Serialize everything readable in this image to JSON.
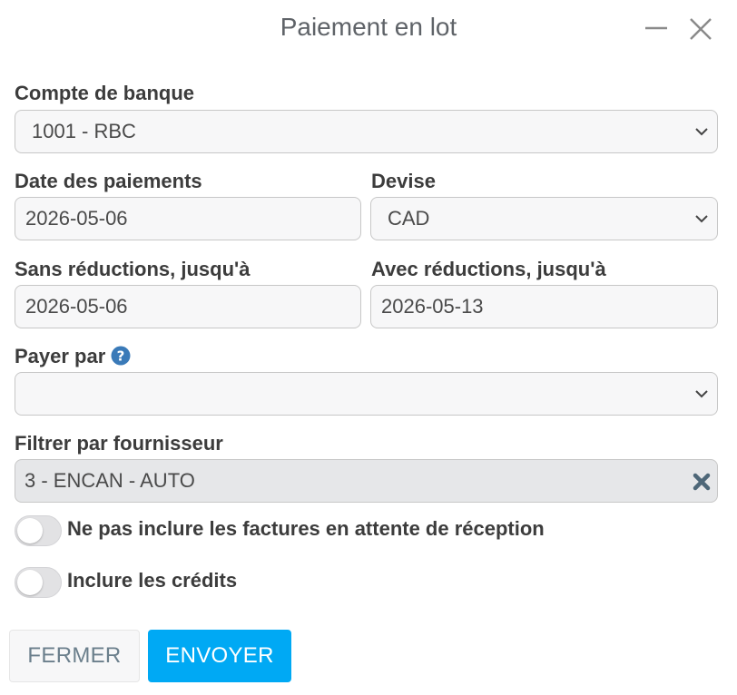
{
  "dialog": {
    "title": "Paiement en lot"
  },
  "form": {
    "bank_account": {
      "label": "Compte de banque",
      "value": "1001 - RBC"
    },
    "payment_date": {
      "label": "Date des paiements",
      "value": "2026-05-06"
    },
    "currency": {
      "label": "Devise",
      "value": "CAD"
    },
    "without_discounts": {
      "label": "Sans réductions, jusqu'à",
      "value": "2026-05-06"
    },
    "with_discounts": {
      "label": "Avec réductions, jusqu'à",
      "value": "2026-05-13"
    },
    "pay_by": {
      "label": "Payer par",
      "value": ""
    },
    "vendor_filter": {
      "label": "Filtrer par fournisseur",
      "value": "3 - ENCAN - AUTO"
    },
    "toggles": [
      {
        "label": "Ne pas inclure les factures en attente de réception",
        "on": false
      },
      {
        "label": "Inclure les crédits",
        "on": false
      }
    ]
  },
  "buttons": {
    "close_label": "FERMER",
    "send_label": "ENVOYER"
  },
  "colors": {
    "accent": "#00a9f4",
    "help_icon": "#3a7ab8"
  }
}
